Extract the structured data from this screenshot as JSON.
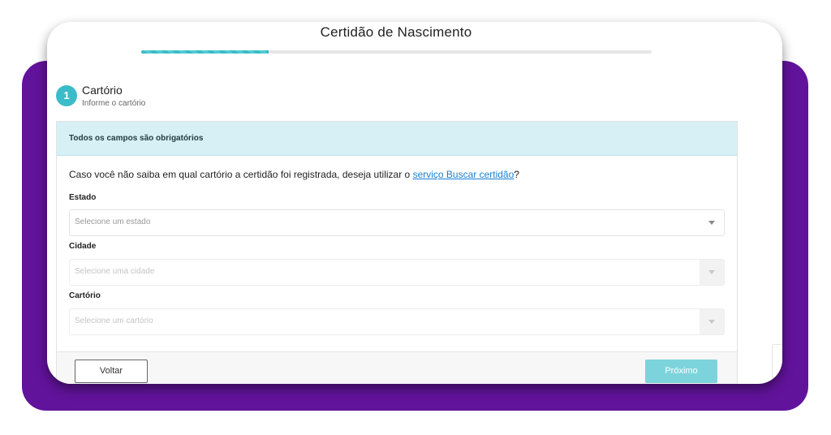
{
  "header": {
    "title": "Certidão de Nascimento",
    "progress": 0.25
  },
  "step": {
    "number": "1",
    "title": "Cartório",
    "subtitle": "Informe o cartório"
  },
  "form": {
    "notice": "Todos os campos são obrigatórios",
    "info_prefix": "Caso você não saiba em qual cartório a certidão foi registrada, deseja utilizar o ",
    "info_link": "serviço Buscar certidão",
    "info_suffix": "?",
    "estado": {
      "label": "Estado",
      "placeholder": "Selecione um estado"
    },
    "cidade": {
      "label": "Cidade",
      "placeholder": "Selecione uma cidade"
    },
    "cartorio": {
      "label": "Cartório",
      "placeholder": "Selecione um cartório"
    }
  },
  "footer": {
    "back_label": "Voltar",
    "next_label": "Próximo"
  },
  "colors": {
    "background_accent": "#62139b",
    "primary": "#3bbcc8",
    "notice_bg": "#d7f0f5",
    "link": "#1a7fd4",
    "next_button": "#7dd3db"
  }
}
